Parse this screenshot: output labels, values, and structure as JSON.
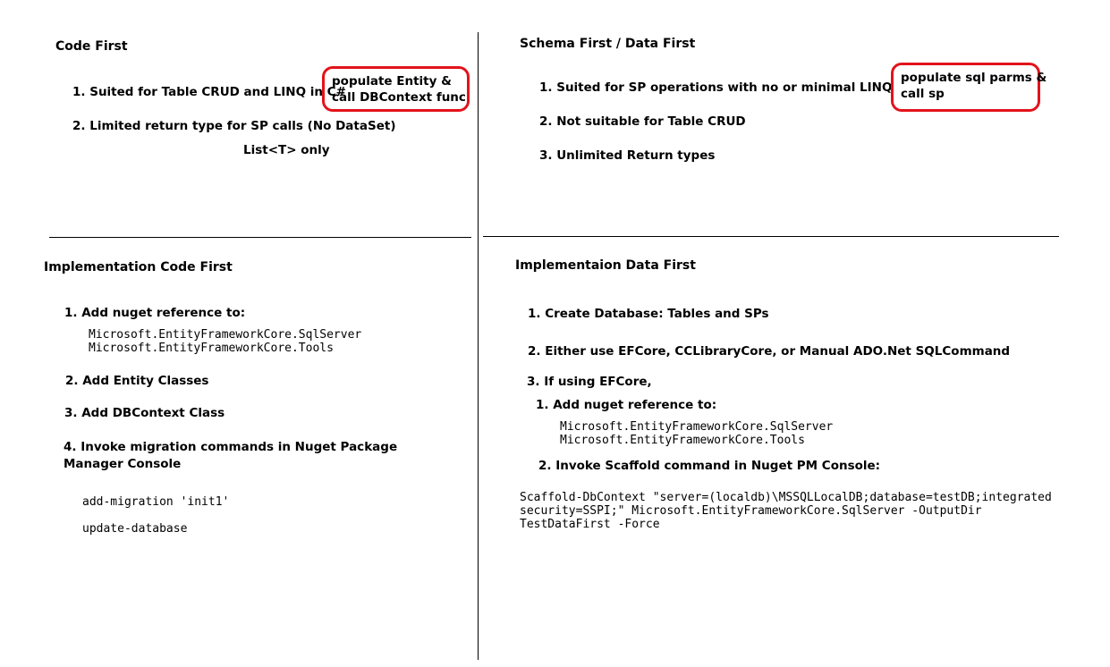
{
  "code_first": {
    "title": "Code First",
    "item1": "1. Suited for Table CRUD and LINQ in C#",
    "item2": "2. Limited return type for SP calls (No DataSet)",
    "item2_sub": "List<T> only",
    "callout_line1": "populate Entity &",
    "callout_line2": "call DBContext func"
  },
  "schema_first": {
    "title": "Schema First / Data First",
    "item1": "1. Suited for SP operations with no or minimal LINQ in C#",
    "item2": "2. Not suitable for Table CRUD",
    "item3": "3. Unlimited Return types",
    "callout_line1": "populate sql parms &",
    "callout_line2": "call sp"
  },
  "impl_code_first": {
    "title": "Implementation Code First",
    "step1": "1. Add nuget reference to:",
    "step1_code": "Microsoft.EntityFrameworkCore.SqlServer\nMicrosoft.EntityFrameworkCore.Tools",
    "step2": "2. Add Entity Classes",
    "step3": "3. Add DBContext Class",
    "step4_line1": "4. Invoke migration commands in Nuget Package",
    "step4_line2": "Manager Console",
    "cmd1": "add-migration 'init1'",
    "cmd2": "update-database"
  },
  "impl_data_first": {
    "title": "Implementaion Data First",
    "step1": "1. Create Database: Tables and SPs",
    "step2": "2. Either use EFCore, CCLibraryCore, or Manual ADO.Net SQLCommand",
    "step3": "3. If using EFCore,",
    "sub1": "1. Add nuget reference to:",
    "sub1_code": "Microsoft.EntityFrameworkCore.SqlServer\nMicrosoft.EntityFrameworkCore.Tools",
    "sub2": "2. Invoke Scaffold command in Nuget PM Console:",
    "scaffold_cmd": "Scaffold-DbContext \"server=(localdb)\\MSSQLLocalDB;database=testDB;integrated\nsecurity=SSPI;\" Microsoft.EntityFrameworkCore.SqlServer -OutputDir\nTestDataFirst -Force"
  },
  "colors": {
    "callout_border": "#e3131b",
    "text": "#000000",
    "lines": "#000000"
  }
}
